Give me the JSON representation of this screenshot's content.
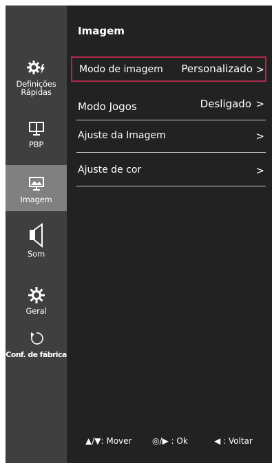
{
  "sidebar": {
    "items": [
      {
        "label": "Definições Rápidas",
        "icon": "quick-settings-icon",
        "selected": false
      },
      {
        "label": "PBP",
        "icon": "pbp-icon",
        "selected": false
      },
      {
        "label": "Imagem",
        "icon": "picture-icon",
        "selected": true
      },
      {
        "label": "Som",
        "icon": "speaker-icon",
        "selected": false
      },
      {
        "label": "Geral",
        "icon": "gear-icon",
        "selected": false
      },
      {
        "label": "Conf. de fábrica",
        "icon": "reset-icon",
        "selected": false
      }
    ]
  },
  "panel": {
    "title": "Imagem",
    "rows": [
      {
        "label": "Modo de imagem",
        "value": "Personalizado",
        "chevron": ">",
        "focused": true
      },
      {
        "label": "Modo Jogos",
        "value": "Desligado",
        "chevron": ">",
        "focused": false
      },
      {
        "label": "Ajuste da Imagem",
        "value": "",
        "chevron": ">",
        "focused": false
      },
      {
        "label": "Ajuste de cor",
        "value": "",
        "chevron": ">",
        "focused": false
      }
    ]
  },
  "footer": {
    "move": "▲/▼: Mover",
    "ok": "◎/▶ : Ok",
    "back": "◀ : Voltar"
  },
  "colors": {
    "sidebar_bg": "#3f3f3f",
    "panel_bg": "#222222",
    "selected_bg": "#808080",
    "focus_border": "#b0274a"
  }
}
